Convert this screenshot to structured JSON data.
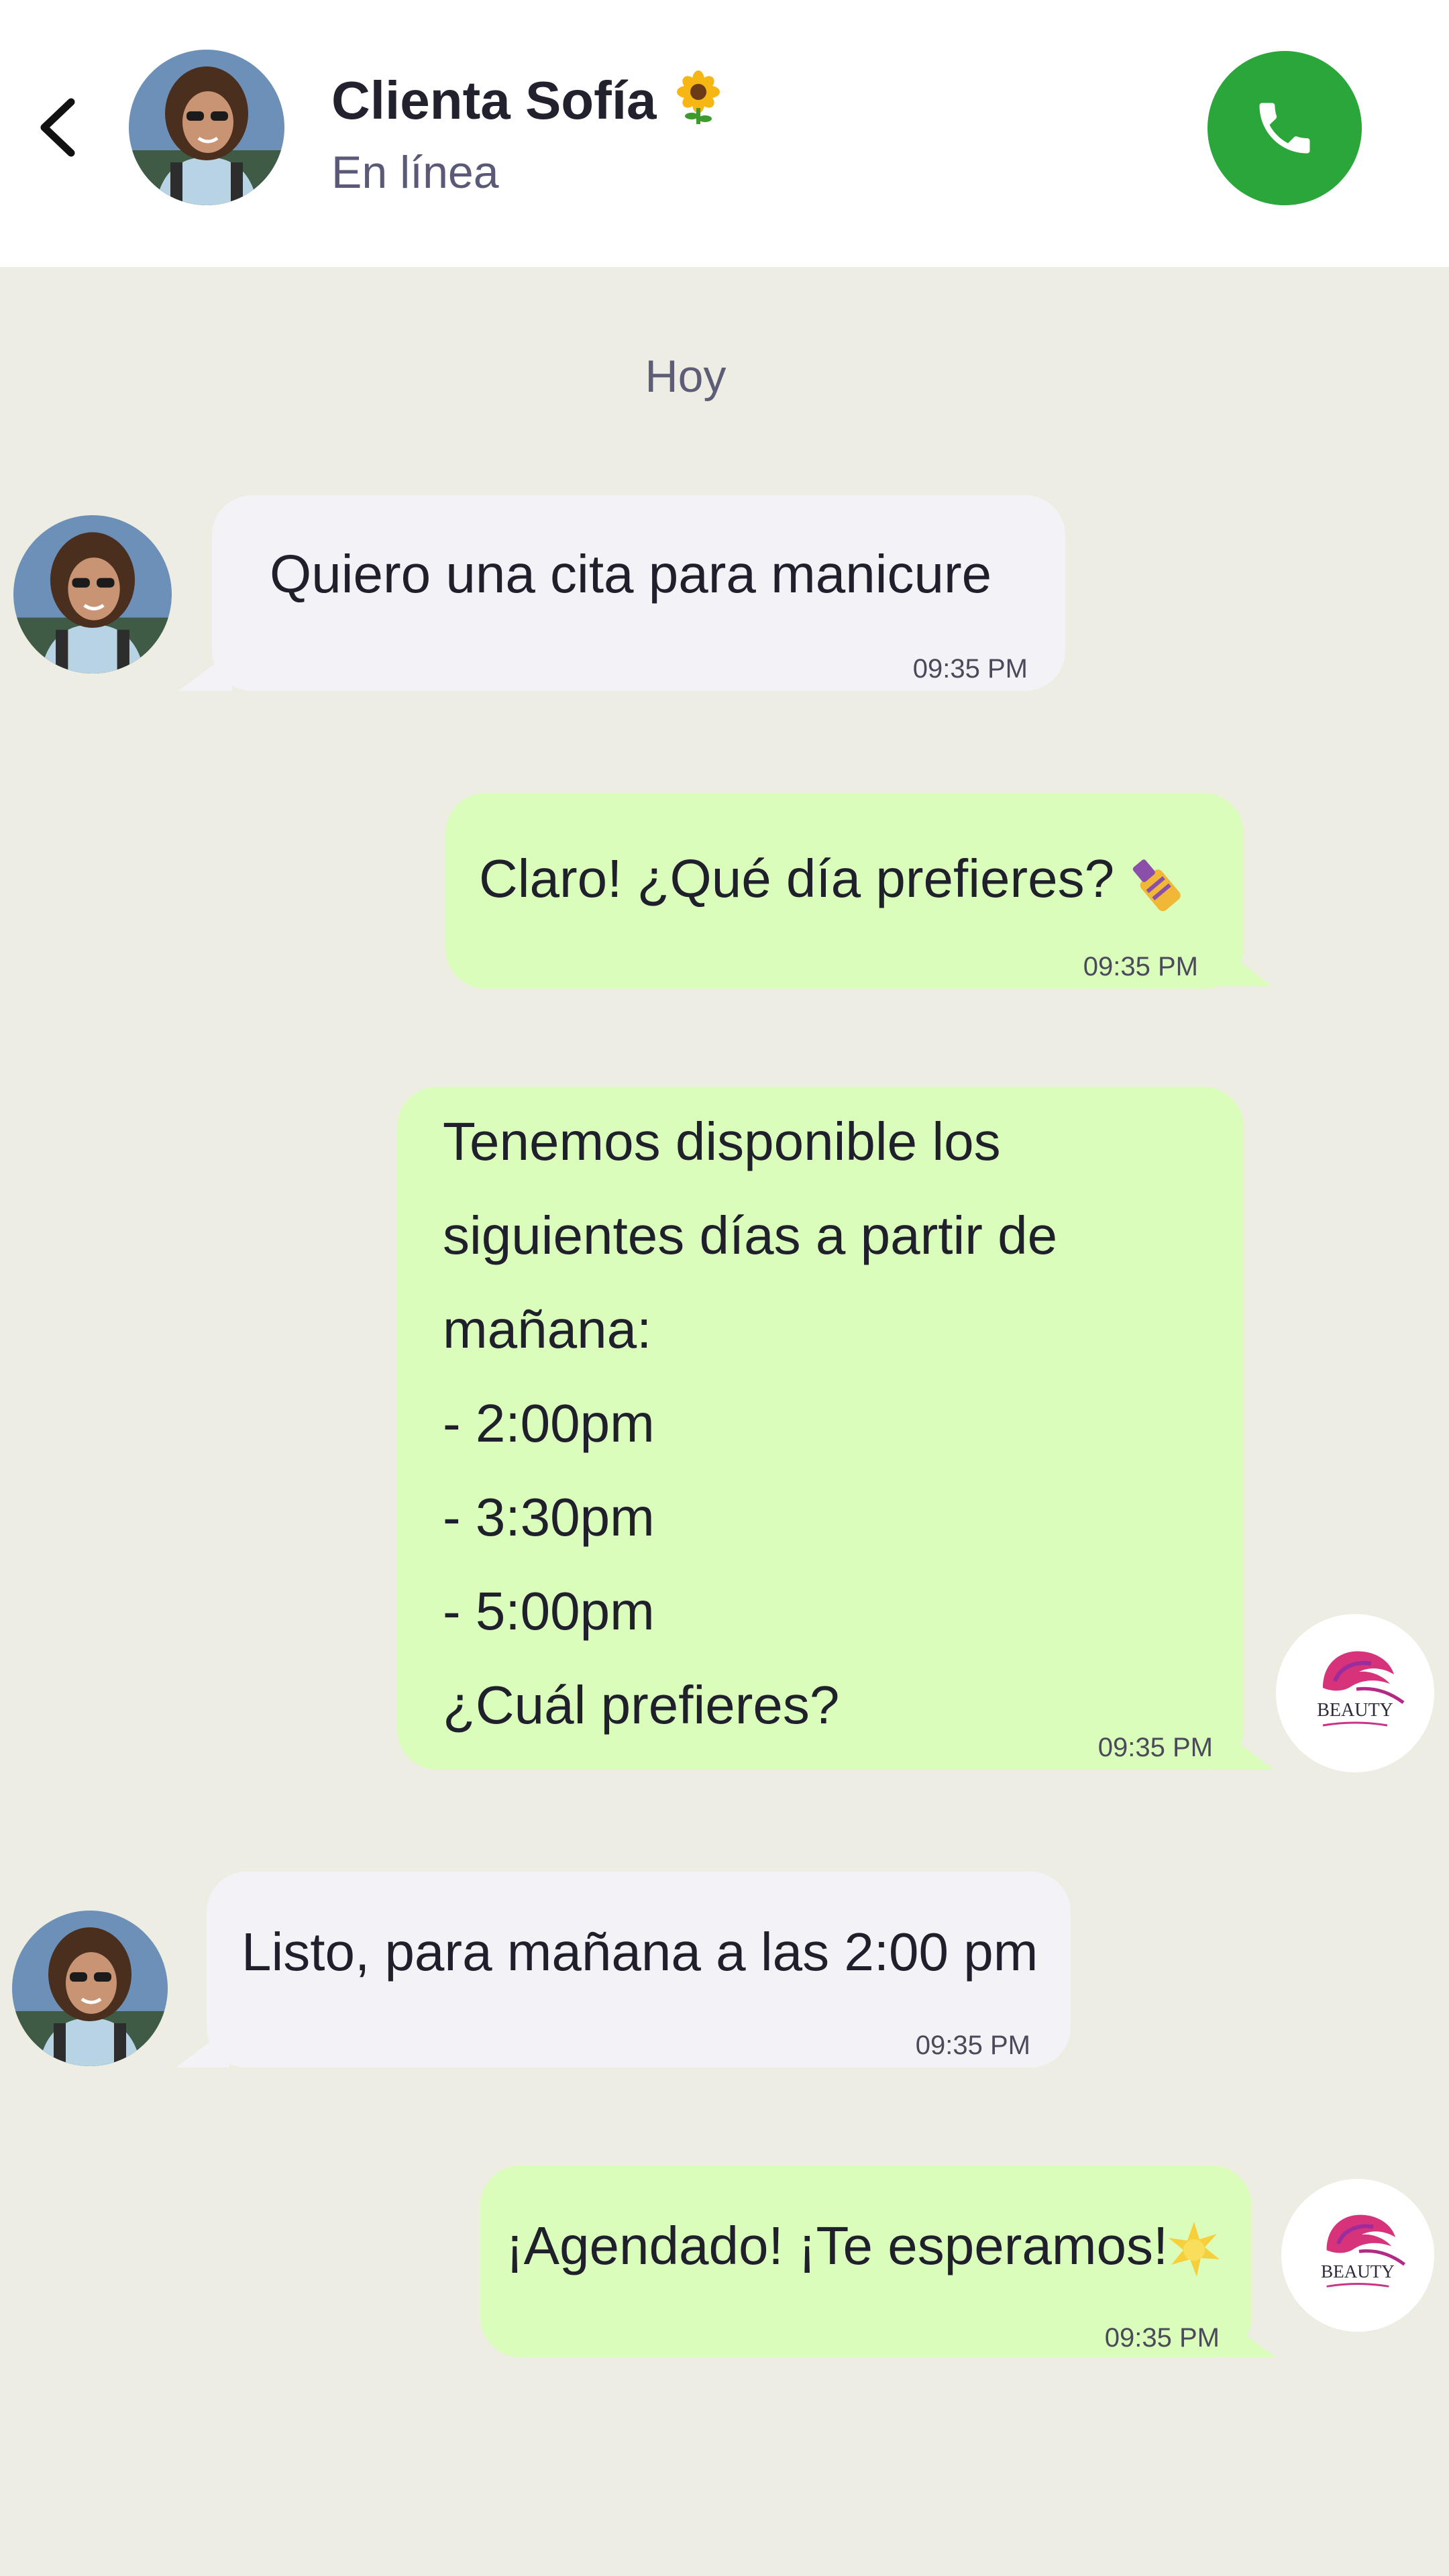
{
  "header": {
    "contact_name": "Clienta Sofía",
    "status": "En línea",
    "back_icon": "chevron-left-icon",
    "call_icon": "phone-icon",
    "name_emoji": "sunflower-icon"
  },
  "chat": {
    "date_separator": "Hoy",
    "messages": [
      {
        "direction": "incoming",
        "text": "Quiero una cita para manicure",
        "time": "09:35 PM"
      },
      {
        "direction": "outgoing",
        "text": "Claro! ¿Qué día prefieres?",
        "time": "09:35 PM",
        "emoji": "nail-polish-icon"
      },
      {
        "direction": "outgoing",
        "lines": [
          "Tenemos disponible los",
          "siguientes días a partir de",
          "mañana:",
          "- 2:00pm",
          "- 3:30pm",
          "- 5:00pm",
          "¿Cuál prefieres?"
        ],
        "time": "09:35 PM"
      },
      {
        "direction": "incoming",
        "text": "Listo, para mañana a las 2:00 pm",
        "time": "09:35 PM"
      },
      {
        "direction": "outgoing",
        "text": "¡Agendado! ¡Te esperamos!",
        "time": "09:35 PM",
        "emoji": "sparkle-icon"
      }
    ]
  },
  "brand_logo": {
    "text": "BEAUTY"
  },
  "colors": {
    "call_button": "#2aa63a",
    "outgoing_bubble": "#dbfdbb",
    "incoming_bubble": "#f3f3f7",
    "chat_background": "#eeede3"
  }
}
